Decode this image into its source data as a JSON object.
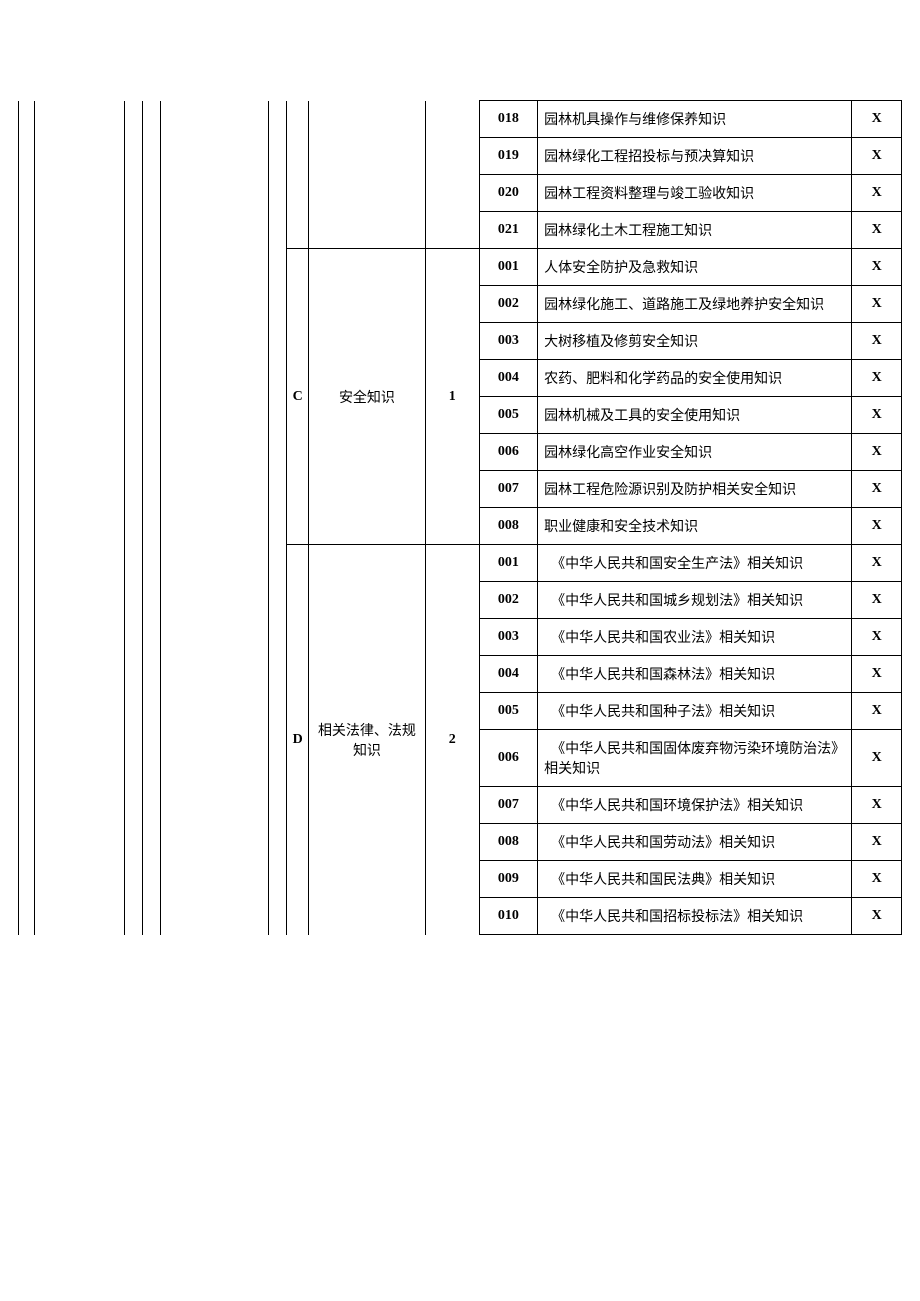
{
  "groups": [
    {
      "letter": "",
      "name": "",
      "number": "",
      "continues": true,
      "items": [
        {
          "code": "018",
          "desc": "园林机具操作与维修保养知识",
          "mark": "X"
        },
        {
          "code": "019",
          "desc": "园林绿化工程招投标与预决算知识",
          "mark": "X"
        },
        {
          "code": "020",
          "desc": "园林工程资料整理与竣工验收知识",
          "mark": "X"
        },
        {
          "code": "021",
          "desc": "园林绿化土木工程施工知识",
          "mark": "X"
        }
      ]
    },
    {
      "letter": "C",
      "name": "安全知识",
      "number": "1",
      "continues": false,
      "items": [
        {
          "code": "001",
          "desc": "人体安全防护及急救知识",
          "mark": "X"
        },
        {
          "code": "002",
          "desc": "园林绿化施工、道路施工及绿地养护安全知识",
          "mark": "X"
        },
        {
          "code": "003",
          "desc": "大树移植及修剪安全知识",
          "mark": "X"
        },
        {
          "code": "004",
          "desc": "农药、肥料和化学药品的安全使用知识",
          "mark": "X"
        },
        {
          "code": "005",
          "desc": "园林机械及工具的安全使用知识",
          "mark": "X"
        },
        {
          "code": "006",
          "desc": "园林绿化高空作业安全知识",
          "mark": "X"
        },
        {
          "code": "007",
          "desc": "园林工程危险源识别及防护相关安全知识",
          "mark": "X"
        },
        {
          "code": "008",
          "desc": "职业健康和安全技术知识",
          "mark": "X"
        }
      ]
    },
    {
      "letter": "D",
      "name": "相关法律、法规知识",
      "number": "2",
      "continues": false,
      "items": [
        {
          "code": "001",
          "desc": "　《中华人民共和国安全生产法》相关知识",
          "mark": "X"
        },
        {
          "code": "002",
          "desc": "　《中华人民共和国城乡规划法》相关知识",
          "mark": "X"
        },
        {
          "code": "003",
          "desc": "　《中华人民共和国农业法》相关知识",
          "mark": "X"
        },
        {
          "code": "004",
          "desc": "　《中华人民共和国森林法》相关知识",
          "mark": "X"
        },
        {
          "code": "005",
          "desc": "　《中华人民共和国种子法》相关知识",
          "mark": "X"
        },
        {
          "code": "006",
          "desc": "　《中华人民共和国固体废弃物污染环境防治法》相关知识",
          "mark": "X"
        },
        {
          "code": "007",
          "desc": "　《中华人民共和国环境保护法》相关知识",
          "mark": "X"
        },
        {
          "code": "008",
          "desc": "　《中华人民共和国劳动法》相关知识",
          "mark": "X"
        },
        {
          "code": "009",
          "desc": "　《中华人民共和国民法典》相关知识",
          "mark": "X"
        },
        {
          "code": "010",
          "desc": "　《中华人民共和国招标投标法》相关知识",
          "mark": "X"
        }
      ]
    }
  ]
}
